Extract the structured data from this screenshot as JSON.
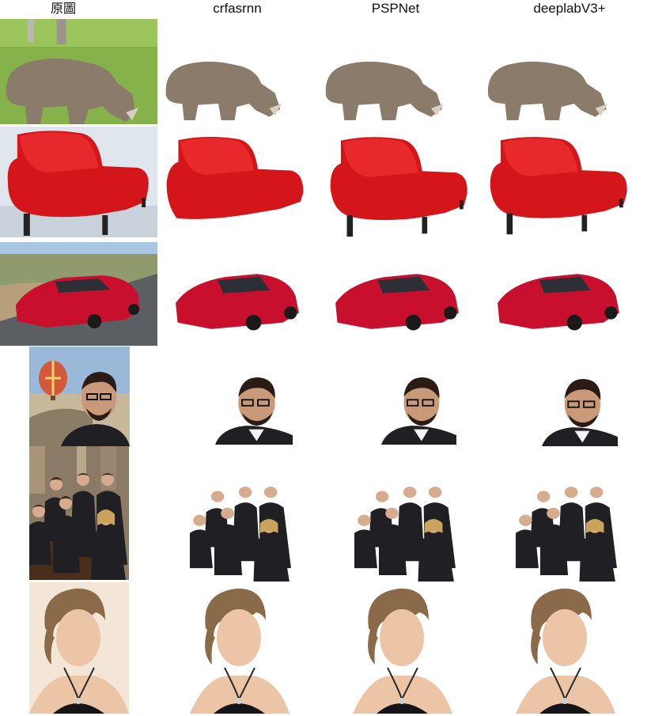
{
  "columns": [
    {
      "key": "original",
      "label": "原圖"
    },
    {
      "key": "crfasrnn",
      "label": "crfasrnn"
    },
    {
      "key": "pspnet",
      "label": "PSPNet"
    },
    {
      "key": "deeplabv3",
      "label": "deeplabV3+"
    }
  ],
  "rows": [
    {
      "subject": "rhinoceros"
    },
    {
      "subject": "red-sofa"
    },
    {
      "subject": "red-sports-car"
    },
    {
      "subject": "man-with-glasses"
    },
    {
      "subject": "business-team"
    },
    {
      "subject": "woman-portrait"
    }
  ],
  "colors": {
    "rhino": "#8a7b6b",
    "sofa": "#d4161b",
    "car": "#c8102e",
    "grass": "#7aa640",
    "sky": "#a9c6e2",
    "skin": "#e6b99a",
    "suit": "#1f1f24",
    "hair": "#6b4a2a"
  }
}
